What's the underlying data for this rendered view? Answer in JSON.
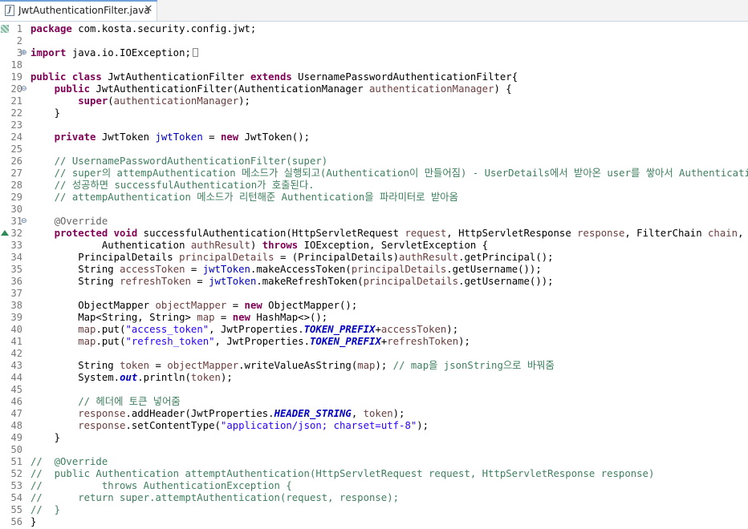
{
  "tab": {
    "title": "JwtAuthenticationFilter.java",
    "close": "✕",
    "icon": "java-file-icon",
    "icon_glyph": "J"
  },
  "lines": [
    {
      "n": "1",
      "tokens": [
        [
          "kw",
          "package"
        ],
        [
          "t",
          " com.kosta.security.config.jwt;"
        ]
      ]
    },
    {
      "n": "2",
      "tokens": []
    },
    {
      "n": "3",
      "fold": "⊕",
      "tokens": [
        [
          "kw",
          "import"
        ],
        [
          "t",
          " java.io.IOException;"
        ],
        [
          "box",
          ""
        ]
      ]
    },
    {
      "n": "18",
      "tokens": []
    },
    {
      "n": "19",
      "tokens": [
        [
          "kw",
          "public class"
        ],
        [
          "t",
          " JwtAuthenticationFilter "
        ],
        [
          "kw",
          "extends"
        ],
        [
          "t",
          " UsernamePasswordAuthenticationFilter{"
        ]
      ]
    },
    {
      "n": "20",
      "fold": "⊖",
      "tokens": [
        [
          "t",
          "    "
        ],
        [
          "kw",
          "public"
        ],
        [
          "t",
          " JwtAuthenticationFilter(AuthenticationManager "
        ],
        [
          "var",
          "authenticationManager"
        ],
        [
          "t",
          ") {"
        ]
      ]
    },
    {
      "n": "21",
      "tokens": [
        [
          "t",
          "        "
        ],
        [
          "kw",
          "super"
        ],
        [
          "t",
          "("
        ],
        [
          "var",
          "authenticationManager"
        ],
        [
          "t",
          ");"
        ]
      ]
    },
    {
      "n": "22",
      "tokens": [
        [
          "t",
          "    }"
        ]
      ]
    },
    {
      "n": "23",
      "tokens": []
    },
    {
      "n": "24",
      "tokens": [
        [
          "t",
          "    "
        ],
        [
          "kw",
          "private"
        ],
        [
          "t",
          " JwtToken "
        ],
        [
          "fld",
          "jwtToken"
        ],
        [
          "t",
          " = "
        ],
        [
          "kw",
          "new"
        ],
        [
          "t",
          " JwtToken();"
        ]
      ]
    },
    {
      "n": "25",
      "tokens": []
    },
    {
      "n": "26",
      "tokens": [
        [
          "cm",
          "    // UsernamePasswordAuthenticationFilter(super)"
        ]
      ]
    },
    {
      "n": "27",
      "tokens": [
        [
          "cm",
          "    // super의 attempAuthentication 메소드가 실행되고(Authentication이 만들어짐) - UserDetails에서 받아온 user를 쌓아서 Authentication을 만들"
        ]
      ]
    },
    {
      "n": "28",
      "tokens": [
        [
          "cm",
          "    // 성공하면 successfulAuthentication가 호출된다."
        ]
      ]
    },
    {
      "n": "29",
      "tokens": [
        [
          "cm",
          "    // attempAuthentication 메소드가 리턴해준 Authentication을 파라미터로 받아옴"
        ]
      ]
    },
    {
      "n": "30",
      "tokens": []
    },
    {
      "n": "31",
      "fold": "⊖",
      "tokens": [
        [
          "ann",
          "    @Override"
        ]
      ]
    },
    {
      "n": "32",
      "marker": "override",
      "tokens": [
        [
          "t",
          "    "
        ],
        [
          "kw",
          "protected void"
        ],
        [
          "t",
          " successfulAuthentication(HttpServletRequest "
        ],
        [
          "var",
          "request"
        ],
        [
          "t",
          ", HttpServletResponse "
        ],
        [
          "var",
          "response"
        ],
        [
          "t",
          ", FilterChain "
        ],
        [
          "var",
          "chain"
        ],
        [
          "t",
          ","
        ]
      ]
    },
    {
      "n": "33",
      "tokens": [
        [
          "t",
          "            Authentication "
        ],
        [
          "var",
          "authResult"
        ],
        [
          "t",
          ") "
        ],
        [
          "kw",
          "throws"
        ],
        [
          "t",
          " IOException, ServletException {"
        ]
      ]
    },
    {
      "n": "34",
      "tokens": [
        [
          "t",
          "        PrincipalDetails "
        ],
        [
          "var",
          "principalDetails"
        ],
        [
          "t",
          " = (PrincipalDetails)"
        ],
        [
          "var",
          "authResult"
        ],
        [
          "t",
          ".getPrincipal();"
        ]
      ]
    },
    {
      "n": "35",
      "tokens": [
        [
          "t",
          "        String "
        ],
        [
          "var",
          "accessToken"
        ],
        [
          "t",
          " = "
        ],
        [
          "fld",
          "jwtToken"
        ],
        [
          "t",
          ".makeAccessToken("
        ],
        [
          "var",
          "principalDetails"
        ],
        [
          "t",
          ".getUsername());"
        ]
      ]
    },
    {
      "n": "36",
      "tokens": [
        [
          "t",
          "        String "
        ],
        [
          "var",
          "refreshToken"
        ],
        [
          "t",
          " = "
        ],
        [
          "fld",
          "jwtToken"
        ],
        [
          "t",
          ".makeRefreshToken("
        ],
        [
          "var",
          "principalDetails"
        ],
        [
          "t",
          ".getUsername());"
        ]
      ]
    },
    {
      "n": "37",
      "tokens": []
    },
    {
      "n": "38",
      "tokens": [
        [
          "t",
          "        ObjectMapper "
        ],
        [
          "var",
          "objectMapper"
        ],
        [
          "t",
          " = "
        ],
        [
          "kw",
          "new"
        ],
        [
          "t",
          " ObjectMapper();"
        ]
      ]
    },
    {
      "n": "39",
      "tokens": [
        [
          "t",
          "        Map<String, String> "
        ],
        [
          "var",
          "map"
        ],
        [
          "t",
          " = "
        ],
        [
          "kw",
          "new"
        ],
        [
          "t",
          " HashMap<>();"
        ]
      ]
    },
    {
      "n": "40",
      "tokens": [
        [
          "t",
          "        "
        ],
        [
          "var",
          "map"
        ],
        [
          "t",
          ".put("
        ],
        [
          "str",
          "\"access_token\""
        ],
        [
          "t",
          ", JwtProperties."
        ],
        [
          "sfld",
          "TOKEN_PREFIX"
        ],
        [
          "t",
          "+"
        ],
        [
          "var",
          "accessToken"
        ],
        [
          "t",
          ");"
        ]
      ]
    },
    {
      "n": "41",
      "tokens": [
        [
          "t",
          "        "
        ],
        [
          "var",
          "map"
        ],
        [
          "t",
          ".put("
        ],
        [
          "str",
          "\"refresh_token\""
        ],
        [
          "t",
          ", JwtProperties."
        ],
        [
          "sfld",
          "TOKEN_PREFIX"
        ],
        [
          "t",
          "+"
        ],
        [
          "var",
          "refreshToken"
        ],
        [
          "t",
          ");"
        ]
      ]
    },
    {
      "n": "42",
      "tokens": []
    },
    {
      "n": "43",
      "tokens": [
        [
          "t",
          "        String "
        ],
        [
          "var",
          "token"
        ],
        [
          "t",
          " = "
        ],
        [
          "var",
          "objectMapper"
        ],
        [
          "t",
          ".writeValueAsString("
        ],
        [
          "var",
          "map"
        ],
        [
          "t",
          "); "
        ],
        [
          "cm",
          "// map을 jsonString으로 바꿔줌"
        ]
      ]
    },
    {
      "n": "44",
      "tokens": [
        [
          "t",
          "        System."
        ],
        [
          "sfld",
          "out"
        ],
        [
          "t",
          ".println("
        ],
        [
          "var",
          "token"
        ],
        [
          "t",
          ");"
        ]
      ]
    },
    {
      "n": "45",
      "tokens": []
    },
    {
      "n": "46",
      "tokens": [
        [
          "cm",
          "        // 헤더에 토큰 넣어줌"
        ]
      ]
    },
    {
      "n": "47",
      "tokens": [
        [
          "t",
          "        "
        ],
        [
          "var",
          "response"
        ],
        [
          "t",
          ".addHeader(JwtProperties."
        ],
        [
          "sfld",
          "HEADER_STRING"
        ],
        [
          "t",
          ", "
        ],
        [
          "var",
          "token"
        ],
        [
          "t",
          ");"
        ]
      ]
    },
    {
      "n": "48",
      "tokens": [
        [
          "t",
          "        "
        ],
        [
          "var",
          "response"
        ],
        [
          "t",
          ".setContentType("
        ],
        [
          "str",
          "\"application/json; charset=utf-8\""
        ],
        [
          "t",
          ");"
        ]
      ]
    },
    {
      "n": "49",
      "tokens": [
        [
          "t",
          "    }"
        ]
      ]
    },
    {
      "n": "50",
      "tokens": []
    },
    {
      "n": "51",
      "tokens": [
        [
          "cm",
          "//  @Override"
        ]
      ]
    },
    {
      "n": "52",
      "tokens": [
        [
          "cm",
          "//  public Authentication attemptAuthentication(HttpServletRequest request, HttpServletResponse response)"
        ]
      ]
    },
    {
      "n": "53",
      "tokens": [
        [
          "cm",
          "//          throws AuthenticationException {"
        ]
      ]
    },
    {
      "n": "54",
      "tokens": [
        [
          "cm",
          "//      return super.attemptAuthentication(request, response);"
        ]
      ]
    },
    {
      "n": "55",
      "tokens": [
        [
          "cm",
          "//  }"
        ]
      ]
    },
    {
      "n": "56",
      "tokens": [
        [
          "t",
          "}"
        ]
      ]
    }
  ]
}
